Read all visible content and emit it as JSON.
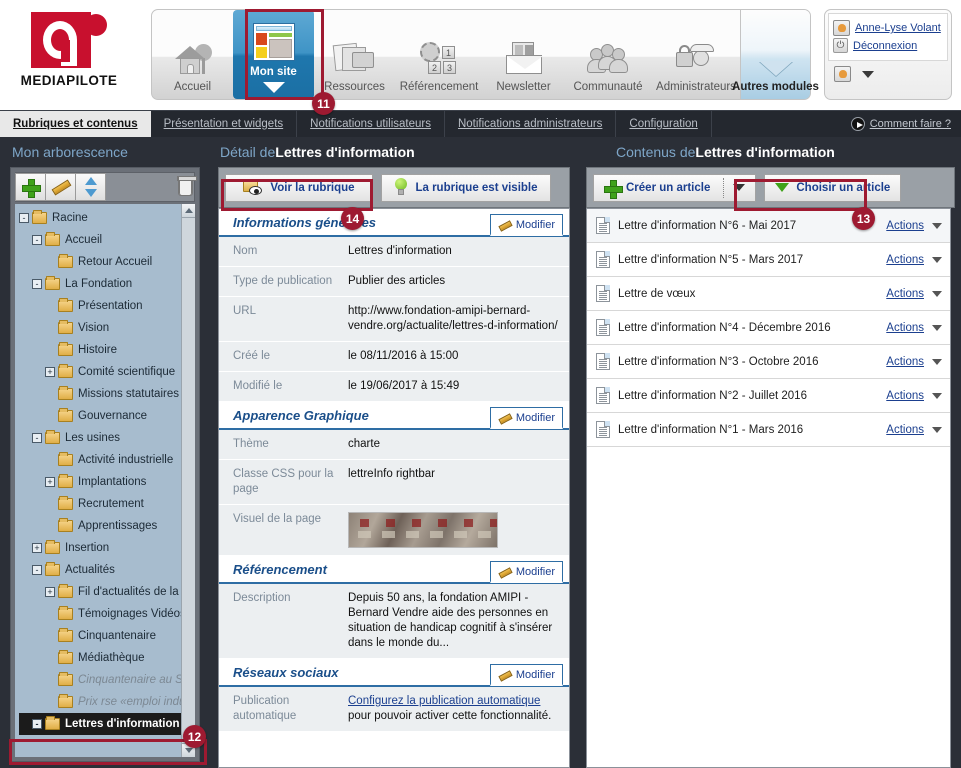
{
  "brand": {
    "name": "MEDIAPILOTE",
    "logo_color": "#c8102e"
  },
  "modules": [
    {
      "label": "Accueil",
      "icon": "house-icon"
    },
    {
      "label": "Mon site",
      "icon": "window-icon",
      "active": true
    },
    {
      "label": "Ressources",
      "icon": "media-icon"
    },
    {
      "label": "Référencement",
      "icon": "seo-icon"
    },
    {
      "label": "Newsletter",
      "icon": "envelope-icon"
    },
    {
      "label": "Communauté",
      "icon": "people-icon"
    },
    {
      "label": "Administrateurs",
      "icon": "lock-user-icon"
    },
    {
      "label": "Autres modules",
      "icon": "chevron-down-icon"
    }
  ],
  "user": {
    "name": "Anne-Lyse Volant",
    "logout": "Déconnexion"
  },
  "tabs": [
    {
      "label": "Rubriques et contenus",
      "selected": true
    },
    {
      "label": "Présentation et widgets",
      "selected": false
    },
    {
      "label": "Notifications utilisateurs",
      "selected": false
    },
    {
      "label": "Notifications administrateurs",
      "selected": false
    },
    {
      "label": "Configuration",
      "selected": false
    }
  ],
  "help": {
    "label": "Comment faire ?"
  },
  "tree": {
    "title": "Mon arborescence",
    "toolbar": [
      {
        "name": "add-node-button",
        "icon": "plus-icon"
      },
      {
        "name": "edit-node-button",
        "icon": "pencil-icon"
      },
      {
        "name": "move-node-button",
        "icon": "up-down-arrows-icon"
      },
      {
        "name": "delete-node-button",
        "icon": "trash-icon"
      }
    ],
    "nodes": [
      {
        "label": "Racine",
        "depth": 0,
        "toggle": "-"
      },
      {
        "label": "Accueil",
        "depth": 1,
        "toggle": "-"
      },
      {
        "label": "Retour Accueil",
        "depth": 2,
        "toggle": ""
      },
      {
        "label": "La Fondation",
        "depth": 1,
        "toggle": "-"
      },
      {
        "label": "Présentation",
        "depth": 2,
        "toggle": ""
      },
      {
        "label": "Vision",
        "depth": 2,
        "toggle": ""
      },
      {
        "label": "Histoire",
        "depth": 2,
        "toggle": ""
      },
      {
        "label": "Comité scientifique",
        "depth": 2,
        "toggle": "+"
      },
      {
        "label": "Missions statutaires",
        "depth": 2,
        "toggle": ""
      },
      {
        "label": "Gouvernance",
        "depth": 2,
        "toggle": ""
      },
      {
        "label": "Les usines",
        "depth": 1,
        "toggle": "-"
      },
      {
        "label": "Activité industrielle",
        "depth": 2,
        "toggle": ""
      },
      {
        "label": "Implantations",
        "depth": 2,
        "toggle": "+"
      },
      {
        "label": "Recrutement",
        "depth": 2,
        "toggle": ""
      },
      {
        "label": "Apprentissages",
        "depth": 2,
        "toggle": ""
      },
      {
        "label": "Insertion",
        "depth": 1,
        "toggle": "+"
      },
      {
        "label": "Actualités",
        "depth": 1,
        "toggle": "-"
      },
      {
        "label": "Fil d'actualités de la fond",
        "depth": 2,
        "toggle": "+"
      },
      {
        "label": "Témoignages Vidéos",
        "depth": 2,
        "toggle": ""
      },
      {
        "label": "Cinquantenaire",
        "depth": 2,
        "toggle": ""
      },
      {
        "label": "Médiathèque",
        "depth": 2,
        "toggle": ""
      },
      {
        "label": "Cinquantenaire au Séna",
        "depth": 2,
        "toggle": "",
        "dim": true
      },
      {
        "label": "Prix rse «emploi industri",
        "depth": 2,
        "toggle": "",
        "dim": true
      },
      {
        "label": "Lettres d'information",
        "depth": 1,
        "toggle": "-",
        "selected": true
      }
    ]
  },
  "detail": {
    "head_prefix": "Détail de ",
    "head_name": "Lettres d'information",
    "buttons": {
      "view": "Voir la rubrique",
      "visible": "La rubrique est visible"
    },
    "sections": [
      {
        "title": "Informations générales",
        "edit_label": "Modifier",
        "rows": [
          {
            "key": "Nom",
            "value": "Lettres d'information"
          },
          {
            "key": "Type de publication",
            "value": "Publier des articles"
          },
          {
            "key": "URL",
            "value": "http://www.fondation-amipi-bernard-vendre.org/actualite/lettres-d-information/"
          },
          {
            "key": "Créé le",
            "value": "le 08/11/2016 à 15:00"
          },
          {
            "key": "Modifié le",
            "value": "le 19/06/2017 à 15:49"
          }
        ]
      },
      {
        "title": "Apparence Graphique",
        "edit_label": "Modifier",
        "rows": [
          {
            "key": "Thème",
            "value": "charte"
          },
          {
            "key": "Classe CSS pour la page",
            "value": "lettreInfo rightbar"
          },
          {
            "key": "Visuel de la page",
            "value": "",
            "image": "page-visual-thumbnail"
          }
        ]
      },
      {
        "title": "Référencement",
        "edit_label": "Modifier",
        "rows": [
          {
            "key": "Description",
            "value": "Depuis 50 ans, la fondation AMIPI - Bernard Vendre aide des personnes en situation de handicap cognitif à s'insérer dans le monde du..."
          }
        ]
      },
      {
        "title": "Réseaux sociaux",
        "edit_label": "Modifier",
        "rows": [
          {
            "key": "Publication automatique",
            "value": "Configurez la publication automatique pour pouvoir activer cette fonctionnalité.",
            "link_text": "Configurez la publication automatique"
          }
        ]
      }
    ]
  },
  "contents": {
    "head_prefix": "Contenus de ",
    "head_name": "Lettres d'information",
    "buttons": {
      "create": "Créer un article",
      "choose": "Choisir un article"
    },
    "action_label": "Actions",
    "articles": [
      {
        "title": "Lettre d'information N°6 - Mai 2017"
      },
      {
        "title": "Lettre d'information N°5 - Mars 2017"
      },
      {
        "title": "Lettre de vœux"
      },
      {
        "title": "Lettre d'information N°4 - Décembre 2016"
      },
      {
        "title": "Lettre d'information N°3 - Octobre 2016"
      },
      {
        "title": "Lettre d'information N°2 - Juillet 2016"
      },
      {
        "title": "Lettre d'information N°1 - Mars 2016"
      }
    ]
  },
  "callouts": [
    {
      "number": "11",
      "target": "mon-site-module"
    },
    {
      "number": "12",
      "target": "tree-node-lettres-information"
    },
    {
      "number": "13",
      "target": "choisir-un-article-button"
    },
    {
      "number": "14",
      "target": "voir-la-rubrique-button"
    }
  ],
  "colors": {
    "callout": "#9e1a31",
    "accent_blue": "#1b3f8f",
    "header_blue": "#7ea6c8"
  }
}
